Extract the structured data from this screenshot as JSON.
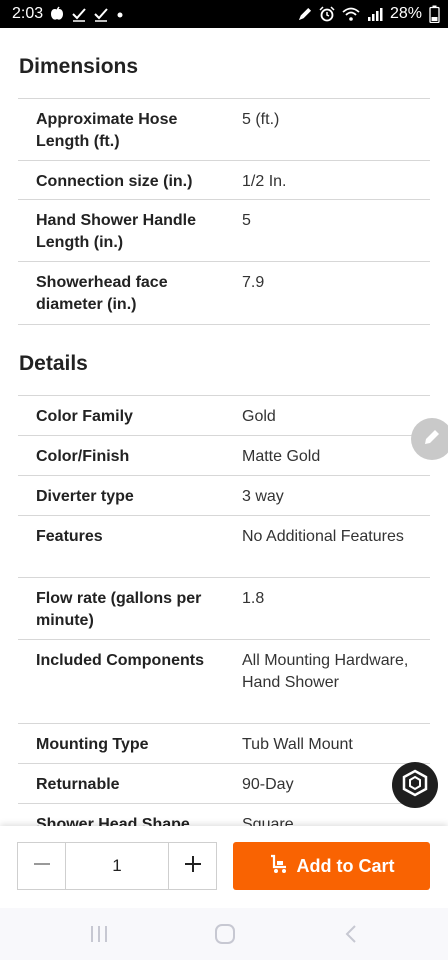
{
  "status_bar": {
    "time": "2:03",
    "battery": "28%",
    "icons": [
      "apple-icon",
      "check-icon",
      "check-icon",
      "dot-icon",
      "pen-icon",
      "alarm-icon",
      "wifi-icon",
      "signal-icon"
    ]
  },
  "dimensions": {
    "title": "Dimensions",
    "rows": [
      {
        "label": "Approximate Hose Length (ft.)",
        "value": "5 (ft.)"
      },
      {
        "label": "Connection size (in.)",
        "value": "1/2 In."
      },
      {
        "label": "Hand Shower Handle Length (in.)",
        "value": "5"
      },
      {
        "label": "Showerhead face diameter (in.)",
        "value": "7.9"
      }
    ]
  },
  "details": {
    "title": "Details",
    "rows": [
      {
        "label": "Color Family",
        "value": "Gold"
      },
      {
        "label": "Color/Finish",
        "value": "Matte Gold"
      },
      {
        "label": "Diverter type",
        "value": "3 way"
      },
      {
        "label": "Features",
        "value": "No Additional Features"
      },
      {
        "label": "Flow rate (gallons per minute)",
        "value": "1.8"
      },
      {
        "label": "Included Components",
        "value": "All Mounting Hardware, Hand Shower"
      },
      {
        "label": "Mounting Type",
        "value": "Tub Wall Mount"
      },
      {
        "label": "Returnable",
        "value": "90-Day"
      },
      {
        "label": "Shower Head Shape",
        "value": "Square"
      }
    ]
  },
  "cart": {
    "quantity": "1",
    "add_label": "Add to Cart",
    "accent": "#f96302"
  }
}
